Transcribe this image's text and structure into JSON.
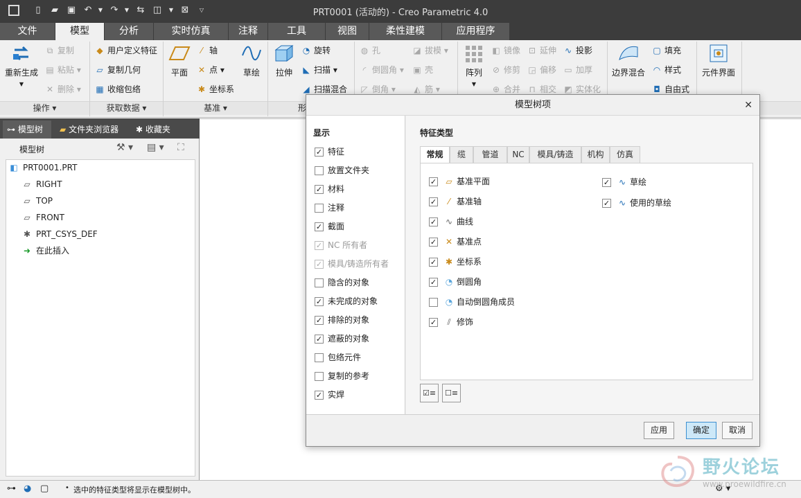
{
  "window": {
    "title": "PRT0001 (活动的) - Creo Parametric 4.0"
  },
  "menu_tabs": [
    "文件",
    "模型",
    "分析",
    "实时仿真",
    "注释",
    "工具",
    "视图",
    "柔性建模",
    "应用程序"
  ],
  "active_tab": "模型",
  "ribbon": {
    "regenerate": "重新生成",
    "copy": "复制",
    "paste": "粘贴",
    "delete": "删除",
    "user_defined_feature": "用户定义特征",
    "copy_geometry": "复制几何",
    "shrinkwrap": "收缩包络",
    "plane": "平面",
    "axis": "轴",
    "point": "点",
    "csys": "坐标系",
    "sketch": "草绘",
    "extrude": "拉伸",
    "revolve": "旋转",
    "sweep": "扫描",
    "swept_blend": "扫描混合",
    "hole": "孔",
    "round": "倒圆角",
    "chamfer": "倒角",
    "draft": "拔模",
    "shell": "壳",
    "rib": "筋",
    "pattern": "阵列",
    "mirror": "镜像",
    "trim": "修剪",
    "merge": "合并",
    "extend": "延伸",
    "offset": "偏移",
    "intersect": "相交",
    "project": "投影",
    "thicken": "加厚",
    "solidify": "实体化",
    "boundary_blend": "边界混合",
    "fill": "填充",
    "style": "样式",
    "freestyle": "自由式",
    "component_interface": "元件界面",
    "groups": {
      "operations": "操作",
      "get_data": "获取数据",
      "datum": "基准",
      "shapes": "形"
    }
  },
  "panel_tabs": [
    "模型树",
    "文件夹浏览器",
    "收藏夹"
  ],
  "model_tree": {
    "header": "模型树",
    "items": [
      {
        "label": "PRT0001.PRT",
        "icon": "part-icon"
      },
      {
        "label": "RIGHT",
        "icon": "datum-plane-icon"
      },
      {
        "label": "TOP",
        "icon": "datum-plane-icon"
      },
      {
        "label": "FRONT",
        "icon": "datum-plane-icon"
      },
      {
        "label": "PRT_CSYS_DEF",
        "icon": "csys-icon"
      },
      {
        "label": "在此插入",
        "icon": "insert-here-icon"
      }
    ]
  },
  "dialog": {
    "title": "模型树项",
    "display_title": "显示",
    "display_items": [
      {
        "label": "特征",
        "checked": true,
        "disabled": false
      },
      {
        "label": "放置文件夹",
        "checked": false,
        "disabled": false
      },
      {
        "label": "材料",
        "checked": true,
        "disabled": false
      },
      {
        "label": "注释",
        "checked": false,
        "disabled": false
      },
      {
        "label": "截面",
        "checked": true,
        "disabled": false
      },
      {
        "label": "NC 所有者",
        "checked": true,
        "disabled": true
      },
      {
        "label": "模具/铸造所有者",
        "checked": true,
        "disabled": true
      },
      {
        "label": "隐含的对象",
        "checked": false,
        "disabled": false
      },
      {
        "label": "未完成的对象",
        "checked": true,
        "disabled": false
      },
      {
        "label": "排除的对象",
        "checked": true,
        "disabled": false
      },
      {
        "label": "遮蔽的对象",
        "checked": true,
        "disabled": false
      },
      {
        "label": "包络元件",
        "checked": false,
        "disabled": false
      },
      {
        "label": "复制的参考",
        "checked": false,
        "disabled": false
      },
      {
        "label": "实焊",
        "checked": true,
        "disabled": false
      }
    ],
    "feature_types_title": "特征类型",
    "feature_tabs": [
      "常规",
      "缆",
      "管道",
      "NC",
      "模具/铸造",
      "机构",
      "仿真"
    ],
    "active_feature_tab": "常规",
    "features_col1": [
      {
        "label": "基准平面",
        "checked": true,
        "icon": "datum-plane-icon"
      },
      {
        "label": "基准轴",
        "checked": true,
        "icon": "datum-axis-icon"
      },
      {
        "label": "曲线",
        "checked": true,
        "icon": "curve-icon"
      },
      {
        "label": "基准点",
        "checked": true,
        "icon": "datum-point-icon"
      },
      {
        "label": "坐标系",
        "checked": true,
        "icon": "csys-icon"
      },
      {
        "label": "倒圆角",
        "checked": true,
        "icon": "round-icon"
      },
      {
        "label": "自动倒圆角成员",
        "checked": false,
        "icon": "auto-round-icon"
      },
      {
        "label": "修饰",
        "checked": true,
        "icon": "cosmetic-icon"
      }
    ],
    "features_col2": [
      {
        "label": "草绘",
        "checked": true,
        "icon": "sketch-icon"
      },
      {
        "label": "使用的草绘",
        "checked": true,
        "icon": "used-sketch-icon"
      }
    ],
    "buttons": {
      "apply": "应用",
      "ok": "确定",
      "cancel": "取消"
    }
  },
  "status": {
    "message": "选中的特征类型将显示在模型树中。"
  },
  "watermark": {
    "text": "野火论坛",
    "url": "www.proewildfire.cn"
  }
}
